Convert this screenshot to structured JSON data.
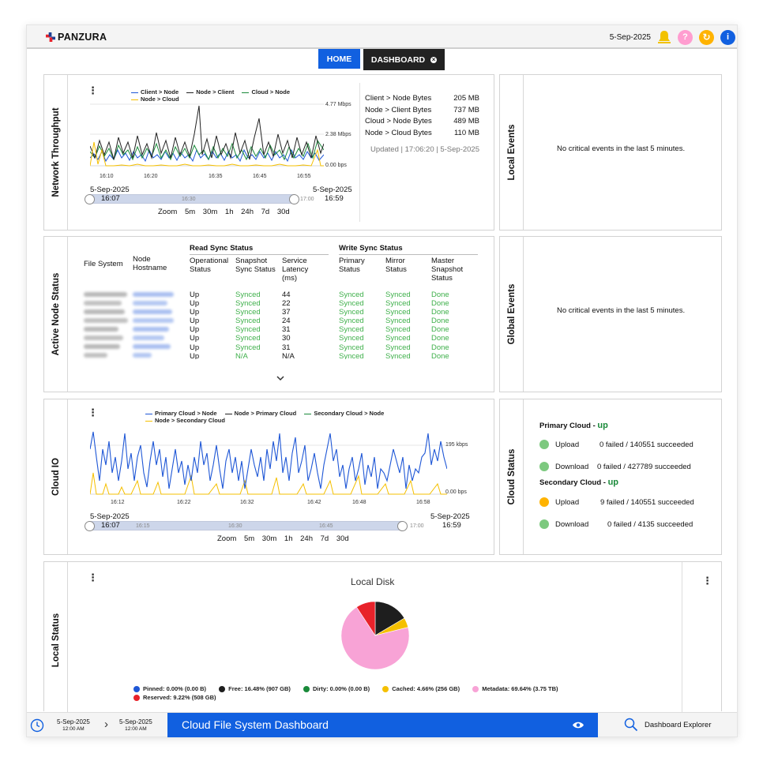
{
  "brand": "PANZURA",
  "header": {
    "date": "5-Sep-2025"
  },
  "colors": {
    "accent": "#1160e0",
    "bell": "#f2c200",
    "help": "#ff9dd0",
    "sync": "#ffb300",
    "info": "#1160e0",
    "green": "#3fb04b"
  },
  "tabs": [
    {
      "label": "HOME"
    },
    {
      "label": "DASHBOARD"
    }
  ],
  "throughput": {
    "title": "Network Throughput",
    "legend": [
      "Client > Node",
      "Node > Client",
      "Cloud > Node",
      "Node > Cloud"
    ],
    "y_ticks": [
      "4.77 Mbps",
      "2.38 Mbps",
      "0.00 bps"
    ],
    "x_ticks": [
      "16:10",
      "16:20",
      "16:35",
      "16:45",
      "16:55"
    ],
    "nav_ticks": [
      "16:30",
      "17:00"
    ],
    "date_left": "5-Sep-2025",
    "date_right": "5-Sep-2025",
    "time_left": "16:07",
    "time_right": "16:59",
    "zoom": [
      "Zoom",
      "5m",
      "30m",
      "1h",
      "24h",
      "7d",
      "30d"
    ],
    "stats": [
      {
        "label": "Client > Node Bytes",
        "value": "205 MB"
      },
      {
        "label": "Node > Client Bytes",
        "value": "737 MB"
      },
      {
        "label": "Cloud > Node Bytes",
        "value": "489 MB"
      },
      {
        "label": "Node > Cloud Bytes",
        "value": "110 MB"
      }
    ],
    "updated": "Updated | 17:06:20 | 5-Sep-2025"
  },
  "local_events": {
    "title": "Local Events",
    "message": "No critical events in the last 5 minutes."
  },
  "global_events": {
    "title": "Global Events",
    "message": "No critical events in the last 5 minutes."
  },
  "active_nodes": {
    "title": "Active Node Status",
    "headers": {
      "file_system": "File System",
      "node_hostname": "Node Hostname",
      "read_group": "Read Sync Status",
      "write_group": "Write Sync Status",
      "operational_status": "Operational Status",
      "snapshot_sync": "Snapshot Sync Status",
      "service_latency": "Service Latency (ms)",
      "primary_status": "Primary Status",
      "mirror_status": "Mirror Status",
      "master_snapshot": "Master Snapshot Status"
    },
    "rows": [
      {
        "op": "Up",
        "snap": "Synced",
        "lat": "44",
        "prim": "Synced",
        "mirr": "Synced",
        "mast": "Done"
      },
      {
        "op": "Up",
        "snap": "Synced",
        "lat": "22",
        "prim": "Synced",
        "mirr": "Synced",
        "mast": "Done"
      },
      {
        "op": "Up",
        "snap": "Synced",
        "lat": "37",
        "prim": "Synced",
        "mirr": "Synced",
        "mast": "Done"
      },
      {
        "op": "Up",
        "snap": "Synced",
        "lat": "24",
        "prim": "Synced",
        "mirr": "Synced",
        "mast": "Done"
      },
      {
        "op": "Up",
        "snap": "Synced",
        "lat": "31",
        "prim": "Synced",
        "mirr": "Synced",
        "mast": "Done"
      },
      {
        "op": "Up",
        "snap": "Synced",
        "lat": "30",
        "prim": "Synced",
        "mirr": "Synced",
        "mast": "Done"
      },
      {
        "op": "Up",
        "snap": "Synced",
        "lat": "31",
        "prim": "Synced",
        "mirr": "Synced",
        "mast": "Done"
      },
      {
        "op": "Up",
        "snap": "N/A",
        "lat": "N/A",
        "prim": "Synced",
        "mirr": "Synced",
        "mast": "Done"
      }
    ]
  },
  "cloud_io": {
    "title": "Cloud IO",
    "legend": [
      "Primary Cloud > Node",
      "Node > Primary Cloud",
      "Secondary Cloud > Node",
      "Node > Secondary Cloud"
    ],
    "y_ticks": [
      "195 kbps",
      "0.00 bps"
    ],
    "x_ticks": [
      "16:12",
      "16:22",
      "16:32",
      "16:42",
      "16:48",
      "16:58"
    ],
    "nav_ticks": [
      "16:15",
      "16:30",
      "16:45",
      "17:00"
    ],
    "date_left": "5-Sep-2025",
    "date_right": "5-Sep-2025",
    "time_left": "16:07",
    "time_right": "16:59",
    "zoom": [
      "Zoom",
      "5m",
      "30m",
      "1h",
      "24h",
      "7d",
      "30d"
    ]
  },
  "cloud_status": {
    "title": "Cloud Status",
    "primary_label": "Primary Cloud - ",
    "primary_state": "up",
    "secondary_label": "Secondary Cloud - ",
    "secondary_state": "up",
    "primary": [
      {
        "label": "Upload",
        "detail": "0 failed / 140551 succeeded",
        "color": "#7dc97f"
      },
      {
        "label": "Download",
        "detail": "0 failed / 427789 succeeded",
        "color": "#7dc97f"
      }
    ],
    "secondary": [
      {
        "label": "Upload",
        "detail": "9 failed / 140551 succeeded",
        "color": "#ffb300"
      },
      {
        "label": "Download",
        "detail": "0 failed / 4135 succeeded",
        "color": "#7dc97f"
      }
    ]
  },
  "local_status": {
    "title": "Local Status",
    "chart_title": "Local Disk"
  },
  "chart_data": {
    "type": "pie",
    "title": "Local Disk",
    "slices": [
      {
        "label": "Pinned: 0.00% (0.00 B)",
        "value": 0.0,
        "color": "#1f57d6"
      },
      {
        "label": "Free: 16.48% (907 GB)",
        "value": 16.48,
        "color": "#1e1e1e"
      },
      {
        "label": "Dirty: 0.00% (0.00 B)",
        "value": 0.0,
        "color": "#1a8a3a"
      },
      {
        "label": "Cached: 4.66% (256 GB)",
        "value": 4.66,
        "color": "#f5c000"
      },
      {
        "label": "Metadata: 69.64% (3.75 TB)",
        "value": 69.64,
        "color": "#f8a3d6"
      },
      {
        "label": "Reserved: 9.22% (508 GB)",
        "value": 9.22,
        "color": "#e8222a"
      }
    ]
  },
  "bottom": {
    "start_date": "5-Sep-2025",
    "start_time": "12:00 AM",
    "end_date": "5-Sep-2025",
    "end_time": "12:00 AM",
    "arrow": "›",
    "title": "Cloud File System Dashboard",
    "explorer": "Dashboard Explorer"
  }
}
